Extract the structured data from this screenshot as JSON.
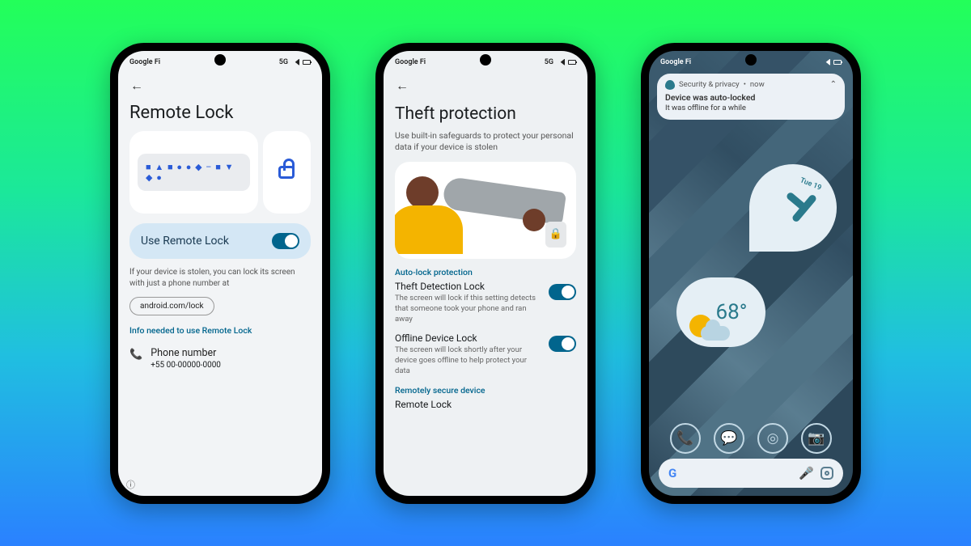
{
  "status": {
    "carrier": "Google Fi",
    "net": "5G"
  },
  "phone1": {
    "title": "Remote Lock",
    "toggle_label": "Use Remote Lock",
    "help": "If your device is stolen, you can lock its screen with just a phone number at",
    "link_chip": "android.com/lock",
    "info_link": "Info needed to use Remote Lock",
    "phone_label": "Phone number",
    "phone_value": "+55 00-00000-0000",
    "glyphs": "■ ▲ ■ ● ● ◆ – ■ ▼ ◆ ●"
  },
  "phone2": {
    "title": "Theft protection",
    "subtitle": "Use built-in safeguards to protect your personal data if your device is stolen",
    "section1": "Auto-lock protection",
    "theft_t": "Theft Detection Lock",
    "theft_d": "The screen will lock if this setting detects that someone took your phone and ran away",
    "offline_t": "Offline Device Lock",
    "offline_d": "The screen will lock shortly after your device goes offline to help protect your data",
    "section2": "Remotely secure device",
    "remote_t": "Remote Lock"
  },
  "phone3": {
    "notif_app": "Security & privacy",
    "notif_time": "now",
    "notif_title": "Device was auto-locked",
    "notif_body": "It was offline for a while",
    "clock_day": "Tue 19",
    "temp": "68°"
  }
}
